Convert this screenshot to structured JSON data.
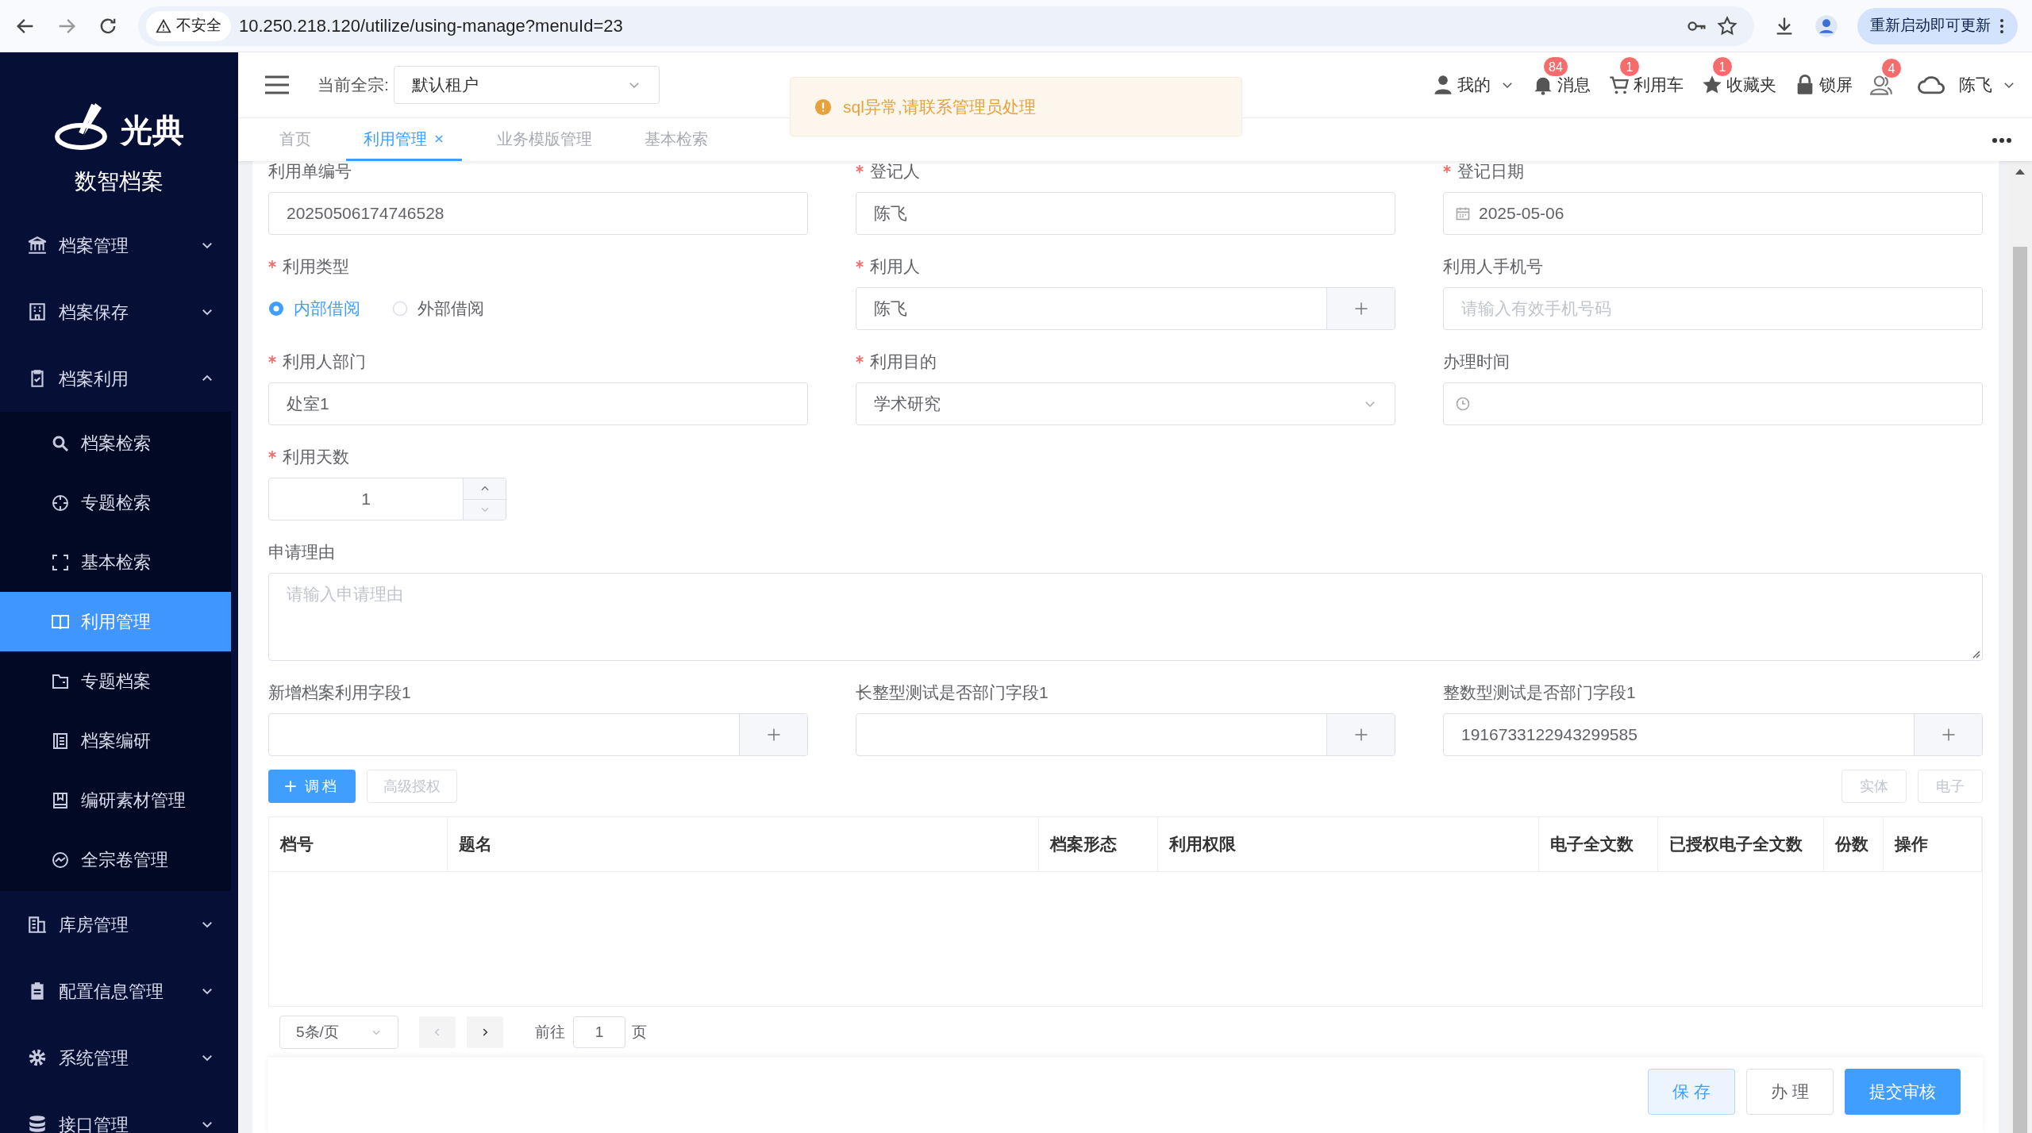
{
  "browser": {
    "security_label": "不安全",
    "url": "10.250.218.120/utilize/using-manage?menuId=23",
    "update_button": "重新启动即可更新"
  },
  "sidebar": {
    "logo_text": "光典",
    "app_name": "数智档案",
    "items": [
      {
        "label": "档案管理",
        "expanded": false
      },
      {
        "label": "档案保存",
        "expanded": false
      },
      {
        "label": "档案利用",
        "expanded": true,
        "children": [
          {
            "label": "档案检索",
            "selected": false
          },
          {
            "label": "专题检索",
            "selected": false
          },
          {
            "label": "基本检索",
            "selected": false
          },
          {
            "label": "利用管理",
            "selected": true
          },
          {
            "label": "专题档案",
            "selected": false
          },
          {
            "label": "档案编研",
            "selected": false
          },
          {
            "label": "编研素材管理",
            "selected": false
          },
          {
            "label": "全宗卷管理",
            "selected": false
          }
        ]
      },
      {
        "label": "库房管理",
        "expanded": false
      },
      {
        "label": "配置信息管理",
        "expanded": false
      },
      {
        "label": "系统管理",
        "expanded": false
      },
      {
        "label": "接口管理",
        "expanded": false
      }
    ]
  },
  "header": {
    "fonds_label": "当前全宗:",
    "fonds_value": "默认租户",
    "toast": "sql异常,请联系管理员处理",
    "actions": [
      {
        "label": "我的",
        "dropdown": true
      },
      {
        "label": "消息",
        "badge": "84"
      },
      {
        "label": "利用车",
        "badge": "1"
      },
      {
        "label": "收藏夹",
        "badge": "1"
      },
      {
        "label": "锁屏"
      },
      {
        "badge": "4"
      },
      {
        "label": "陈飞",
        "dropdown": true
      }
    ]
  },
  "tabs": [
    {
      "label": "首页",
      "selected": false,
      "closable": false
    },
    {
      "label": "利用管理",
      "selected": true,
      "closable": true
    },
    {
      "label": "业务模版管理",
      "selected": false,
      "closable": false
    },
    {
      "label": "基本检索",
      "selected": false,
      "closable": false
    }
  ],
  "form": {
    "fields": [
      {
        "kind": "text",
        "label": "利用单编号",
        "required": false,
        "value": "20250506174746528"
      },
      {
        "kind": "text",
        "label": "登记人",
        "required": true,
        "value": "陈飞"
      },
      {
        "kind": "date",
        "label": "登记日期",
        "required": true,
        "value": "2025-05-06"
      },
      {
        "kind": "radio",
        "label": "利用类型",
        "required": true,
        "options": [
          {
            "label": "内部借阅",
            "selected": true
          },
          {
            "label": "外部借阅",
            "selected": false
          }
        ]
      },
      {
        "kind": "picker",
        "label": "利用人",
        "required": true,
        "value": "陈飞"
      },
      {
        "kind": "text",
        "label": "利用人手机号",
        "required": false,
        "placeholder": "请输入有效手机号码"
      },
      {
        "kind": "text",
        "label": "利用人部门",
        "required": true,
        "value": "处室1"
      },
      {
        "kind": "select",
        "label": "利用目的",
        "required": true,
        "value": "学术研究"
      },
      {
        "kind": "time",
        "label": "办理时间",
        "required": false
      },
      {
        "kind": "number",
        "label": "利用天数",
        "required": true,
        "value": "1"
      },
      {
        "kind": "textarea",
        "label": "申请理由",
        "required": false,
        "placeholder": "请输入申请理由"
      },
      {
        "kind": "picker",
        "label": "新增档案利用字段1",
        "required": false
      },
      {
        "kind": "picker",
        "label": "长整型测试是否部门字段1",
        "required": false
      },
      {
        "kind": "picker",
        "label": "整数型测试是否部门字段1",
        "required": false,
        "value": "1916733122943299585"
      }
    ]
  },
  "toolbar": {
    "left": [
      {
        "label": "调档",
        "kind": "primary",
        "disabled": false
      },
      {
        "label": "高级授权",
        "kind": "plain",
        "disabled": true
      }
    ],
    "right": [
      {
        "label": "实体",
        "disabled": true
      },
      {
        "label": "电子",
        "disabled": true
      }
    ]
  },
  "table": {
    "columns": [
      "档号",
      "题名",
      "档案形态",
      "利用权限",
      "电子全文数",
      "已授权电子全文数",
      "份数",
      "操作"
    ]
  },
  "pagination": {
    "page_size": "5条/页",
    "goto_label": "前往",
    "page": "1",
    "page_unit": "页"
  },
  "footer_buttons": [
    {
      "label": "保 存",
      "kind": "light"
    },
    {
      "label": "办 理",
      "kind": "plain"
    },
    {
      "label": "提交审核",
      "kind": "primary"
    }
  ]
}
